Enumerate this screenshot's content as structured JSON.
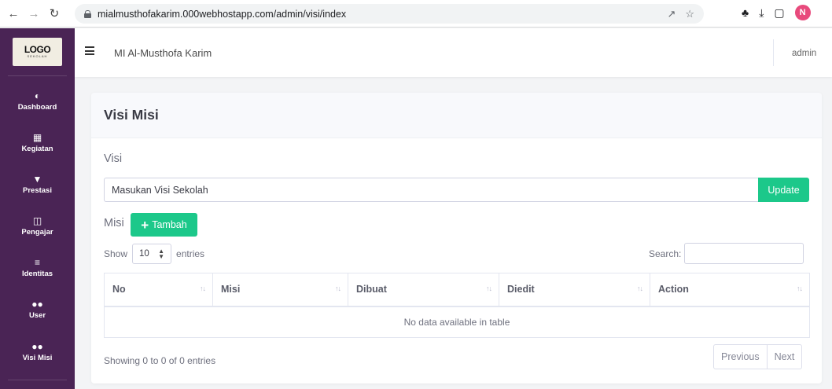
{
  "browser": {
    "url": "mialmusthofakarim.000webhostapp.com/admin/visi/index",
    "back_icon": "arrow-left",
    "forward_icon": "arrow-right",
    "reload_icon": "reload",
    "profile_initial": "N"
  },
  "sidebar": {
    "logo_text": "LOGO",
    "logo_sub": "SEKOLAH",
    "items": [
      {
        "label": "Dashboard",
        "icon": "tachometer"
      },
      {
        "label": "Kegiatan",
        "icon": "calendar"
      },
      {
        "label": "Prestasi",
        "icon": "trophy"
      },
      {
        "label": "Pengajar",
        "icon": "chalkboard-teacher"
      },
      {
        "label": "Identitas",
        "icon": "sliders"
      },
      {
        "label": "User",
        "icon": "users"
      },
      {
        "label": "Visi Misi",
        "icon": "users"
      }
    ]
  },
  "header": {
    "site_title": "MI Al-Musthofa Karim",
    "username": "admin"
  },
  "card": {
    "title": "Visi Misi",
    "visi_label": "Visi",
    "visi_value": "Masukan Visi Sekolah",
    "update_label": "Update",
    "misi_label": "Misi",
    "tambah_label": "Tambah"
  },
  "datatable": {
    "show_label": "Show",
    "length_value": "10",
    "entries_label": "entries",
    "search_label": "Search:",
    "columns": [
      "No",
      "Misi",
      "Dibuat",
      "Diedit",
      "Action"
    ],
    "empty_text": "No data available in table",
    "info": "Showing 0 to 0 of 0 entries",
    "previous_label": "Previous",
    "next_label": "Next"
  },
  "colors": {
    "sidebar": "#4a2455",
    "success": "#1cc88a",
    "profile": "#e84a7c"
  }
}
